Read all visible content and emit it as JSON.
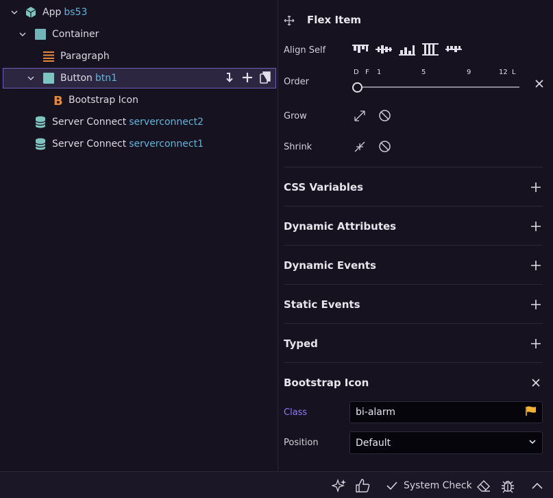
{
  "tree": {
    "items": [
      {
        "label": "App",
        "id": "bs53"
      },
      {
        "label": "Container",
        "id": ""
      },
      {
        "label": "Paragraph",
        "id": ""
      },
      {
        "label": "Button",
        "id": "btn1"
      },
      {
        "label": "Bootstrap Icon",
        "id": ""
      },
      {
        "label": "Server Connect",
        "id": "serverconnect2"
      },
      {
        "label": "Server Connect",
        "id": "serverconnect1"
      }
    ]
  },
  "props": {
    "flex_title": "Flex Item",
    "align_self_label": "Align Self",
    "order_label": "Order",
    "order_ticks": [
      "D",
      "F",
      "1",
      "5",
      "9",
      "12",
      "L"
    ],
    "grow_label": "Grow",
    "shrink_label": "Shrink",
    "sections": [
      "CSS Variables",
      "Dynamic Attributes",
      "Dynamic Events",
      "Static Events",
      "Typed"
    ],
    "bootstrap_title": "Bootstrap Icon",
    "class_label": "Class",
    "class_value": "bi-alarm",
    "position_label": "Position",
    "position_value": "Default"
  },
  "footer": {
    "system_check": "System Check"
  },
  "colors": {
    "accent": "#7f6df2",
    "id_blue": "#63b4dc",
    "teal": "#7ec4c0",
    "orange": "#e58a3c",
    "flag": "#f2b233"
  }
}
